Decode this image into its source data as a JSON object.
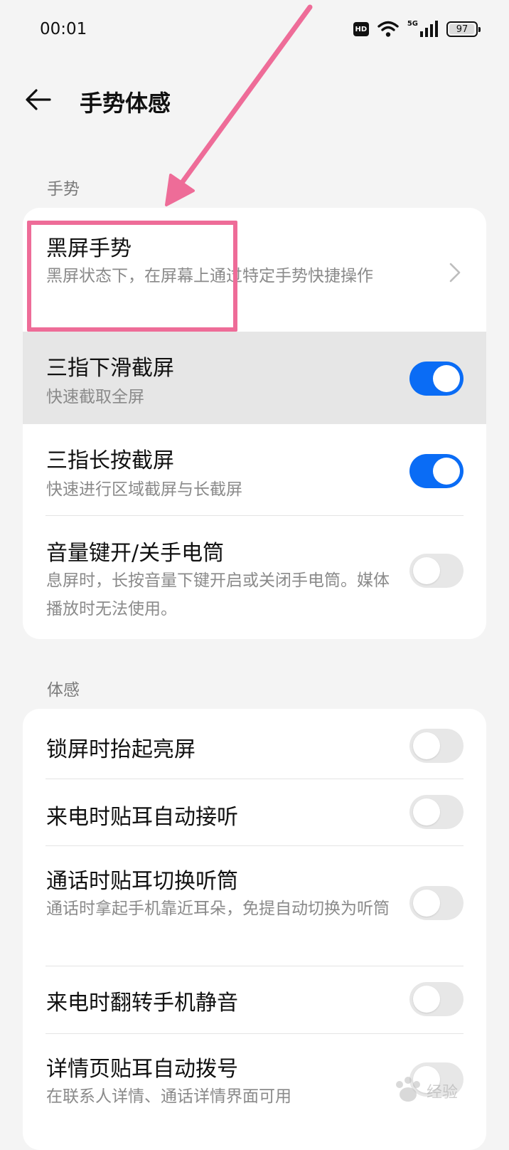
{
  "status_bar": {
    "time": "00:01",
    "hd_badge": "HD",
    "network": "5G",
    "battery": "97",
    "battery_level_percent": 97
  },
  "header": {
    "title": "手势体感",
    "back_icon": "arrow-left-icon"
  },
  "sections": [
    {
      "label": "手势",
      "items": [
        {
          "title": "黑屏手势",
          "subtitle": "黑屏状态下，在屏幕上通过特定手势快捷操作",
          "control": "chevron"
        },
        {
          "title": "三指下滑截屏",
          "subtitle": "快速截取全屏",
          "control": "switch",
          "on": true
        },
        {
          "title": "三指长按截屏",
          "subtitle": "快速进行区域截屏与长截屏",
          "control": "switch",
          "on": true
        },
        {
          "title": "音量键开/关手电筒",
          "subtitle": "息屏时，长按音量下键开启或关闭手电筒。媒体播放时无法使用。",
          "control": "switch",
          "on": false
        }
      ]
    },
    {
      "label": "体感",
      "items": [
        {
          "title": "锁屏时抬起亮屏",
          "control": "switch",
          "on": false
        },
        {
          "title": "来电时贴耳自动接听",
          "control": "switch",
          "on": false
        },
        {
          "title": "通话时贴耳切换听筒",
          "subtitle": "通话时拿起手机靠近耳朵，免提自动切换为听筒",
          "control": "switch",
          "on": false
        },
        {
          "title": "来电时翻转手机静音",
          "control": "switch",
          "on": false
        },
        {
          "title": "详情页贴耳自动拨号",
          "subtitle": "在联系人详情、通话详情界面可用",
          "control": "switch",
          "on": false
        }
      ]
    }
  ],
  "colors": {
    "accent": "#0a6cf5",
    "annotation": "#ee6c98",
    "background": "#f4f4f4"
  },
  "watermark": "Baidu经验"
}
